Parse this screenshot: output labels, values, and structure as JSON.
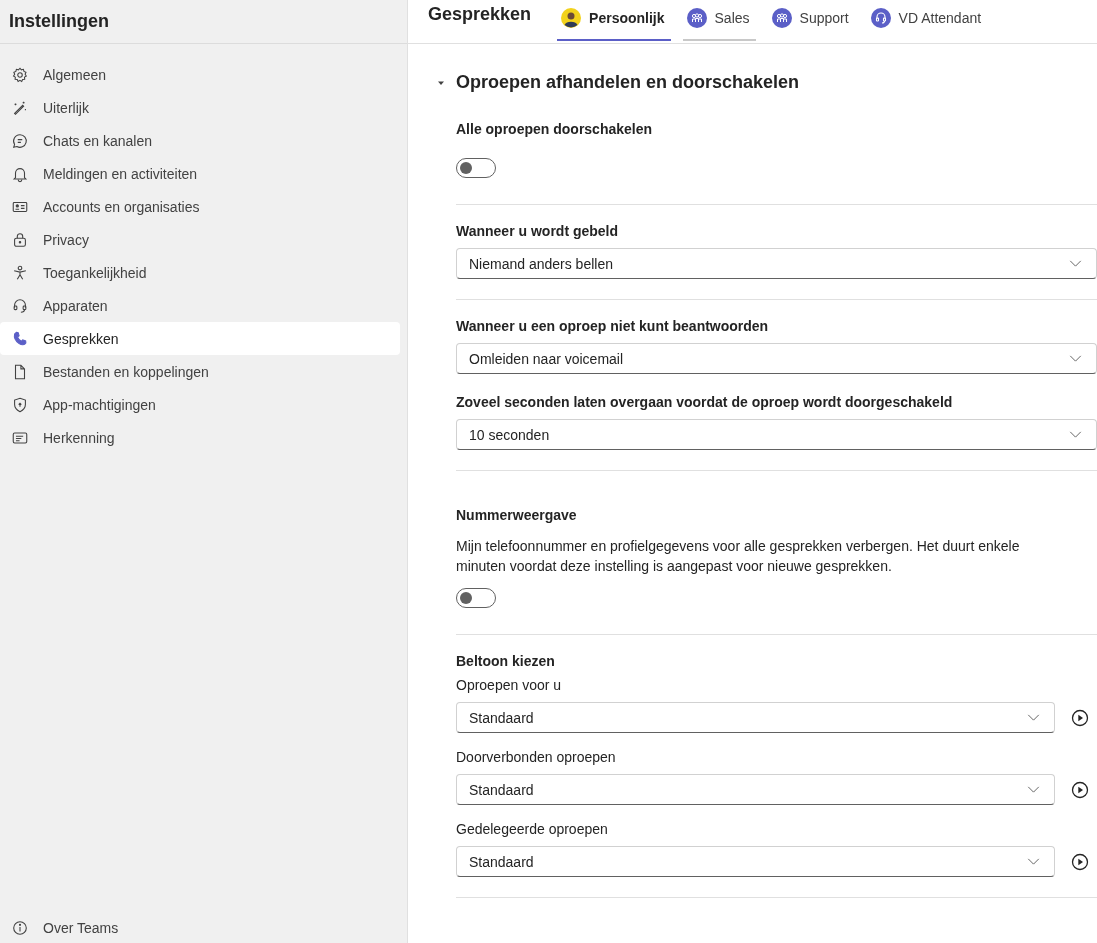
{
  "sidebar": {
    "title": "Instellingen",
    "items": [
      {
        "label": "Algemeen",
        "selected": false
      },
      {
        "label": "Uiterlijk",
        "selected": false
      },
      {
        "label": "Chats en kanalen",
        "selected": false
      },
      {
        "label": "Meldingen en activiteiten",
        "selected": false
      },
      {
        "label": "Accounts en organisaties",
        "selected": false
      },
      {
        "label": "Privacy",
        "selected": false
      },
      {
        "label": "Toegankelijkheid",
        "selected": false
      },
      {
        "label": "Apparaten",
        "selected": false
      },
      {
        "label": "Gesprekken",
        "selected": true
      },
      {
        "label": "Bestanden en koppelingen",
        "selected": false
      },
      {
        "label": "App-machtigingen",
        "selected": false
      },
      {
        "label": "Herkenning",
        "selected": false
      }
    ],
    "footer": {
      "label": "Over Teams"
    }
  },
  "header": {
    "title": "Gesprekken",
    "tabs": [
      {
        "label": "Persoonlijk",
        "selected": true,
        "hovered": false
      },
      {
        "label": "Sales",
        "selected": false,
        "hovered": true
      },
      {
        "label": "Support",
        "selected": false,
        "hovered": false
      },
      {
        "label": "VD Attendant",
        "selected": false,
        "hovered": false
      }
    ]
  },
  "panel": {
    "heading": "Oproepen afhandelen en doorschakelen",
    "expanded": true,
    "sections": [
      {
        "title": "Alle oproepen doorschakelen",
        "controls": [
          {
            "kind": "toggle",
            "on": false
          }
        ]
      },
      {
        "title": "Wanneer u wordt gebeld",
        "controls": [
          {
            "kind": "select",
            "value": "Niemand anders bellen"
          }
        ]
      },
      {
        "title": "Wanneer u een oproep niet kunt beantwoorden",
        "controls": [
          {
            "kind": "select",
            "value": "Omleiden naar voicemail"
          },
          {
            "kind": "select",
            "label": "Zoveel seconden laten overgaan voordat de oproep wordt doorgeschakeld",
            "value": "10 seconden"
          }
        ]
      },
      {
        "title": "Nummerweergave",
        "description": "Mijn telefoonnummer en profielgegevens voor alle gesprekken verbergen. Het duurt enkele minuten voordat deze instelling is aangepast voor nieuwe gesprekken.",
        "controls": [
          {
            "kind": "toggle",
            "on": false
          }
        ]
      },
      {
        "title": "Beltoon kiezen",
        "controls": [
          {
            "kind": "select-play",
            "label": "Oproepen voor u",
            "value": "Standaard"
          },
          {
            "kind": "select-play",
            "label": "Doorverbonden oproepen",
            "value": "Standaard"
          },
          {
            "kind": "select-play",
            "label": "Gedelegeerde oproepen",
            "value": "Standaard"
          }
        ]
      }
    ]
  }
}
